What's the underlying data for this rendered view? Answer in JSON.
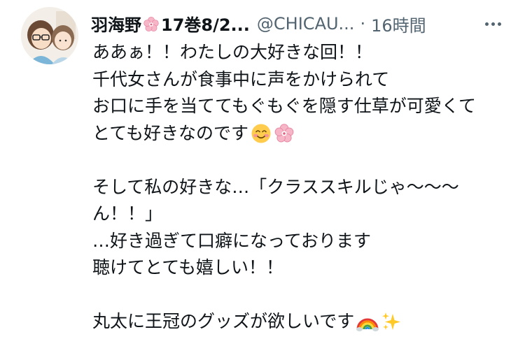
{
  "tweet": {
    "author": {
      "display_name": "羽海野",
      "display_name_suffix": "17巻8/2...",
      "name_emoji": "cherry-blossom-icon",
      "handle": "@CHICAU...",
      "avatar": "avatar-illustration"
    },
    "separator": "·",
    "time": "16時間",
    "more_icon": "more-options-icon",
    "lines": [
      {
        "text": "ああぁ！！わたしの大好きな回！！"
      },
      {
        "text": "千代女さんが食事中に声をかけられて"
      },
      {
        "text": "お口に手を当ててもぐもぐを隠す仕草が可愛くて"
      },
      {
        "text": "とても好きなのです",
        "emojis": [
          "smiling-face-icon",
          "cherry-blossom-icon"
        ]
      },
      {
        "text": ""
      },
      {
        "text": "そして私の好きな…「クラススキルじゃ〜〜〜"
      },
      {
        "text": "ん！！」"
      },
      {
        "text": "…好き過ぎて口癖になっております"
      },
      {
        "text": "聴けてとても嬉しい！！"
      },
      {
        "text": ""
      },
      {
        "text": "丸太に王冠のグッズが欲しいです",
        "emojis": [
          "rainbow-icon",
          "sparkles-icon"
        ]
      }
    ]
  },
  "colors": {
    "text": "#0f1419",
    "secondary": "#536471",
    "background": "#ffffff",
    "blossom": "#f7b6c8"
  }
}
